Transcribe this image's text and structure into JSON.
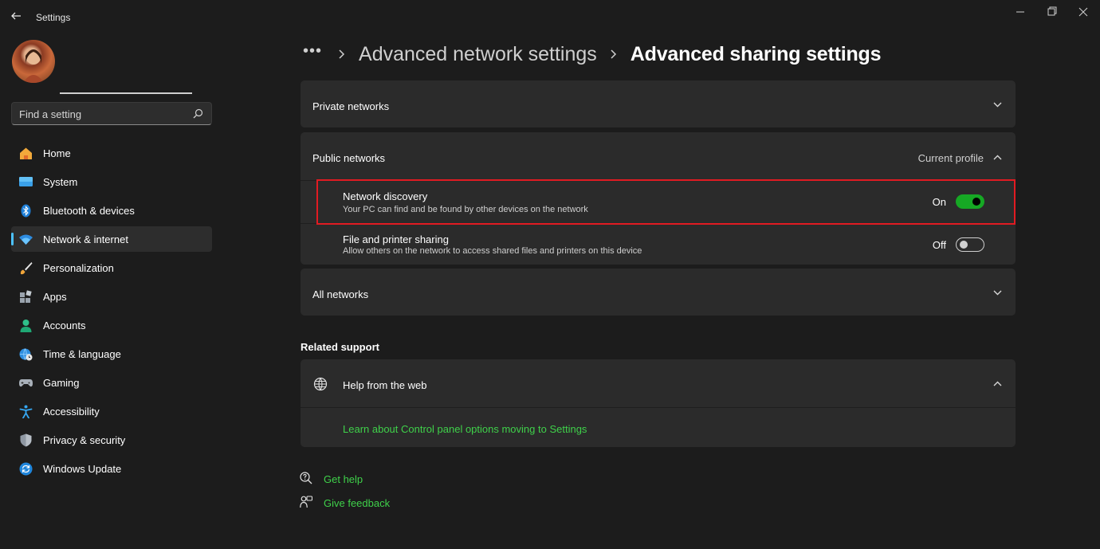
{
  "window": {
    "title": "Settings"
  },
  "search": {
    "placeholder": "Find a setting"
  },
  "nav": [
    {
      "label": "Home",
      "icon": "home-icon"
    },
    {
      "label": "System",
      "icon": "system-icon"
    },
    {
      "label": "Bluetooth & devices",
      "icon": "bluetooth-icon"
    },
    {
      "label": "Network & internet",
      "icon": "network-icon",
      "active": true
    },
    {
      "label": "Personalization",
      "icon": "brush-icon"
    },
    {
      "label": "Apps",
      "icon": "apps-icon"
    },
    {
      "label": "Accounts",
      "icon": "account-icon"
    },
    {
      "label": "Time & language",
      "icon": "globe-clock-icon"
    },
    {
      "label": "Gaming",
      "icon": "gamepad-icon"
    },
    {
      "label": "Accessibility",
      "icon": "accessibility-icon"
    },
    {
      "label": "Privacy & security",
      "icon": "shield-icon"
    },
    {
      "label": "Windows Update",
      "icon": "update-icon"
    }
  ],
  "breadcrumb": {
    "more": "•••",
    "parent": "Advanced network settings",
    "current": "Advanced sharing settings"
  },
  "private_networks": {
    "title": "Private networks"
  },
  "public_networks": {
    "title": "Public networks",
    "badge": "Current profile",
    "network_discovery": {
      "title": "Network discovery",
      "description": "Your PC can find and be found by other devices on the network",
      "state": "On"
    },
    "file_sharing": {
      "title": "File and printer sharing",
      "description": "Allow others on the network to access shared files and printers on this device",
      "state": "Off"
    }
  },
  "all_networks": {
    "title": "All networks"
  },
  "related_support": {
    "heading": "Related support",
    "help_web": {
      "title": "Help from the web",
      "link": "Learn about Control panel options moving to Settings"
    }
  },
  "footer": {
    "get_help": "Get help",
    "give_feedback": "Give feedback"
  },
  "colors": {
    "accent": "#4cc2ff",
    "toggle_on": "#16a824",
    "link": "#3fd14a",
    "highlight": "#e11b22"
  }
}
